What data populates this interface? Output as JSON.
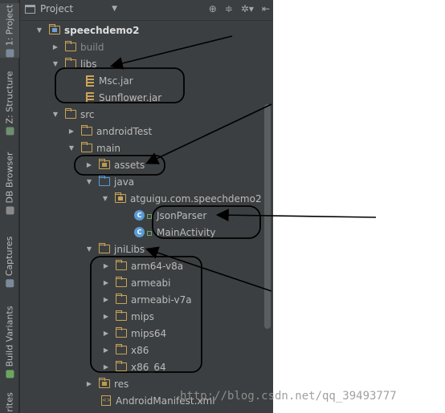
{
  "toolstrip": {
    "tabs": [
      {
        "label": "1: Project"
      },
      {
        "label": "Z: Structure"
      },
      {
        "label": "DB Browser"
      },
      {
        "label": "Captures"
      },
      {
        "label": "Build Variants"
      },
      {
        "label": "rites"
      }
    ]
  },
  "header": {
    "title": "Project",
    "tools": [
      "target-icon",
      "collapse-icon",
      "gear-icon",
      "hide-icon"
    ]
  },
  "tree": [
    {
      "label": "speechdemo2",
      "icon": "module-folder-icon",
      "expanded": true,
      "bold": true
    },
    {
      "label": "build",
      "icon": "folder-icon",
      "expanded": false
    },
    {
      "label": "libs",
      "icon": "folder-icon",
      "expanded": true
    },
    {
      "label": "Msc.jar",
      "icon": "jar-icon"
    },
    {
      "label": "Sunflower.jar",
      "icon": "jar-icon"
    },
    {
      "label": "src",
      "icon": "folder-icon",
      "expanded": true
    },
    {
      "label": "androidTest",
      "icon": "folder-icon",
      "expanded": false
    },
    {
      "label": "main",
      "icon": "folder-icon",
      "expanded": true
    },
    {
      "label": "assets",
      "icon": "resource-folder-icon",
      "expanded": false
    },
    {
      "label": "java",
      "icon": "source-folder-icon",
      "expanded": true
    },
    {
      "label": "atguigu.com.speechdemo2",
      "icon": "package-icon",
      "expanded": true
    },
    {
      "label": "JsonParser",
      "icon": "class-icon"
    },
    {
      "label": "MainActivity",
      "icon": "class-icon"
    },
    {
      "label": "jniLibs",
      "icon": "folder-icon",
      "expanded": true
    },
    {
      "label": "arm64-v8a",
      "icon": "folder-icon",
      "expanded": false
    },
    {
      "label": "armeabi",
      "icon": "folder-icon",
      "expanded": false
    },
    {
      "label": "armeabi-v7a",
      "icon": "folder-icon",
      "expanded": false
    },
    {
      "label": "mips",
      "icon": "folder-icon",
      "expanded": false
    },
    {
      "label": "mips64",
      "icon": "folder-icon",
      "expanded": false
    },
    {
      "label": "x86",
      "icon": "folder-icon",
      "expanded": false
    },
    {
      "label": "x86_64",
      "icon": "folder-icon",
      "expanded": false
    },
    {
      "label": "res",
      "icon": "resource-folder-icon",
      "expanded": false
    },
    {
      "label": "AndroidManifest.xml",
      "icon": "xml-file-icon"
    }
  ],
  "watermark": "http://blog.csdn.net/qq_39493777"
}
